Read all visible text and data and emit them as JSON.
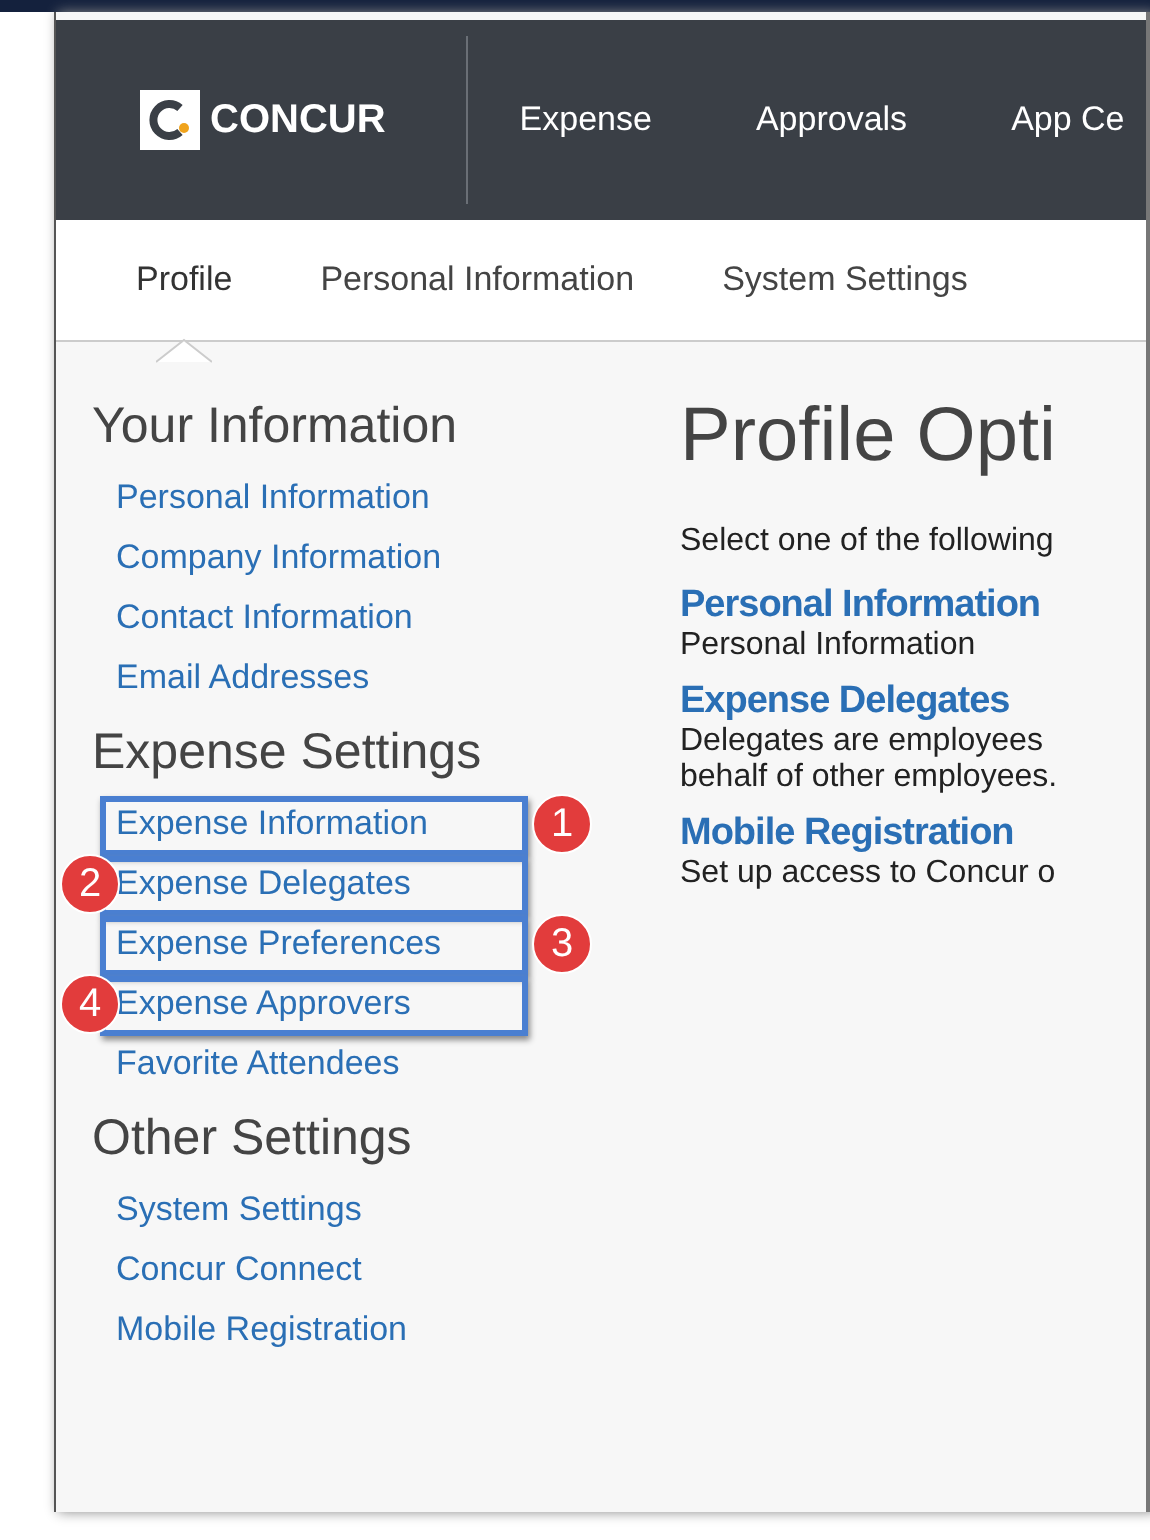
{
  "logo": {
    "text": "CONCUR"
  },
  "nav": [
    {
      "label": "Expense"
    },
    {
      "label": "Approvals"
    },
    {
      "label": "App Ce"
    }
  ],
  "subnav": [
    {
      "label": "Profile",
      "selected": true
    },
    {
      "label": "Personal Information",
      "selected": false
    },
    {
      "label": "System Settings",
      "selected": false
    }
  ],
  "sidebar": [
    {
      "heading": "Your Information",
      "items": [
        {
          "label": "Personal Information"
        },
        {
          "label": "Company Information"
        },
        {
          "label": "Contact Information"
        },
        {
          "label": "Email Addresses"
        }
      ]
    },
    {
      "heading": "Expense Settings",
      "items": [
        {
          "label": "Expense Information",
          "marker": "1",
          "kind": "marker-right"
        },
        {
          "label": "Expense Delegates",
          "marker": "2",
          "kind": "marker-left"
        },
        {
          "label": "Expense Preferences",
          "marker": "3",
          "kind": "marker-right"
        },
        {
          "label": "Expense Approvers",
          "marker": "4",
          "kind": "marker-left"
        },
        {
          "label": "Favorite Attendees"
        }
      ]
    },
    {
      "heading": "Other Settings",
      "items": [
        {
          "label": "System Settings"
        },
        {
          "label": "Concur Connect"
        },
        {
          "label": "Mobile Registration"
        }
      ]
    }
  ],
  "main": {
    "title": "Profile Opti",
    "intro": "Select one of the following",
    "options": [
      {
        "title": "Personal Information",
        "lines": [
          "Personal Information"
        ]
      },
      {
        "title": "Expense Delegates",
        "lines": [
          "Delegates are employees",
          "behalf of other employees."
        ]
      },
      {
        "title": "Mobile Registration",
        "lines": [
          "Set up access to Concur o"
        ]
      }
    ]
  }
}
